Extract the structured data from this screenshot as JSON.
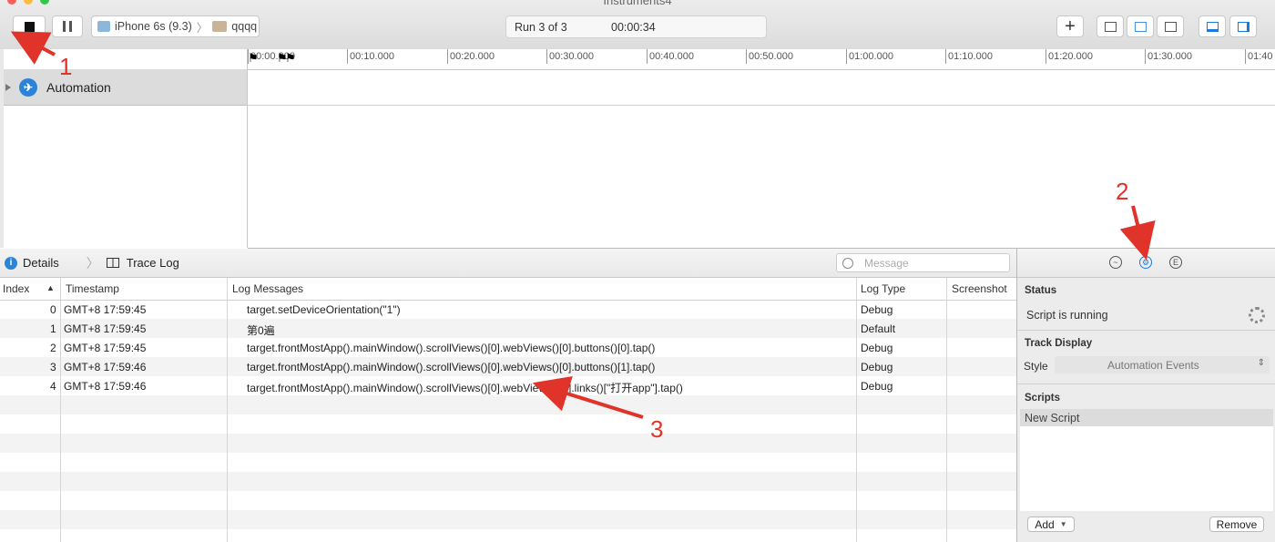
{
  "window": {
    "title": "Instruments4"
  },
  "toolbar": {
    "target_device": "iPhone 6s (9.3)",
    "target_app": "qqqq",
    "run_label": "Run 3 of 3",
    "elapsed": "00:00:34",
    "add_label": "+"
  },
  "timeline": {
    "ticks": [
      "00:00.000",
      "00:10.000",
      "00:20.000",
      "00:30.000",
      "00:40.000",
      "00:50.000",
      "01:00.000",
      "01:10.000",
      "01:20.000",
      "01:30.000",
      "01:40"
    ]
  },
  "instruments": [
    {
      "name": "Automation",
      "icon": "automation-icon"
    }
  ],
  "detail_bar": {
    "crumb_details": "Details",
    "crumb_trace_log": "Trace Log",
    "search_placeholder": "Message"
  },
  "table": {
    "columns": [
      "Index",
      "Timestamp",
      "Log Messages",
      "Log Type",
      "Screenshot"
    ],
    "rows": [
      {
        "index": "0",
        "timestamp": "GMT+8 17:59:45",
        "message": "target.setDeviceOrientation(\"1\")",
        "type": "Debug"
      },
      {
        "index": "1",
        "timestamp": "GMT+8 17:59:45",
        "message": "第0遍",
        "type": "Default"
      },
      {
        "index": "2",
        "timestamp": "GMT+8 17:59:45",
        "message": "target.frontMostApp().mainWindow().scrollViews()[0].webViews()[0].buttons()[0].tap()",
        "type": "Debug"
      },
      {
        "index": "3",
        "timestamp": "GMT+8 17:59:46",
        "message": "target.frontMostApp().mainWindow().scrollViews()[0].webViews()[0].buttons()[1].tap()",
        "type": "Debug"
      },
      {
        "index": "4",
        "timestamp": "GMT+8 17:59:46",
        "message": "target.frontMostApp().mainWindow().scrollViews()[0].webViews()[0].links()[\"打开app\"].tap()",
        "type": "Debug"
      }
    ]
  },
  "inspector": {
    "status_title": "Status",
    "status_text": "Script is running",
    "track_display_title": "Track Display",
    "style_label": "Style",
    "style_value": "Automation Events",
    "scripts_title": "Scripts",
    "script_item": "New Script",
    "add_button": "Add",
    "remove_button": "Remove"
  },
  "annotations": {
    "a1": "1",
    "a2": "2",
    "a3": "3",
    "color": "#e0332a"
  }
}
